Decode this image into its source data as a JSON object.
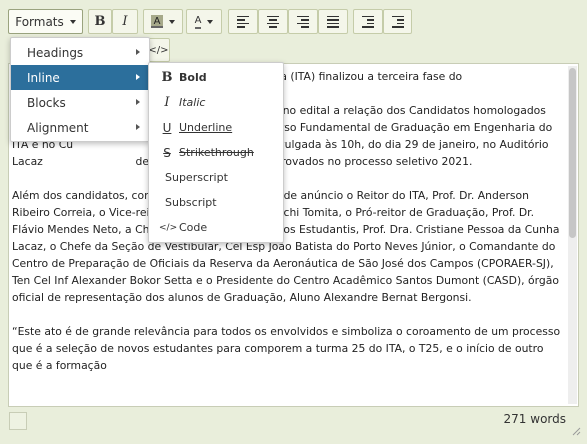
{
  "toolbar": {
    "formats_label": "Formats",
    "bold_glyph": "B",
    "italic_glyph": "I",
    "bgcolor_glyph": "A",
    "textcolor_glyph": "A",
    "code_glyph": "</>"
  },
  "menu": {
    "items": [
      {
        "label": "Headings"
      },
      {
        "label": "Inline"
      },
      {
        "label": "Blocks"
      },
      {
        "label": "Alignment"
      }
    ],
    "active_index": 1
  },
  "submenu": {
    "items": [
      {
        "label": "Bold",
        "icon": "B"
      },
      {
        "label": "Italic",
        "icon": "I"
      },
      {
        "label": "Underline",
        "icon": "U"
      },
      {
        "label": "Strikethrough",
        "icon": "S"
      },
      {
        "label": "Superscript",
        "icon": ""
      },
      {
        "label": "Subscript",
        "icon": ""
      },
      {
        "label": "Code",
        "icon": "</>"
      }
    ]
  },
  "editor": {
    "paragraphs": [
      "                                              lógico de Aeronáutica (ITA) finalizou a terceira fase do",
      "                                              cumentação exigida no edital a relação dos Candidatos homologados pela Junta Es                           matriculados no Curso Fundamental de Graduação em Engenharia do ITA e no Cu                           ais da Reserva, foi divulgada às 10h, do dia 29 de janeiro, no Auditório Lacaz                           definida a lista final dos aprovados no processo seletivo 2021.",
      "Além dos candidatos, compareceram à cerimônia de anúncio o Reitor do ITA, Prof. Dr. Anderson Ribeiro Correia, o Vice-reitor, Prof. Dr. Jesuíno Takachi Tomita, o Pró-reitor de Graduação, Prof. Dr. Flávio Mendes Neto, a Chefe da Divisão de Assuntos Estudantis, Prof. Dra. Cristiane Pessoa da Cunha Lacaz, o Chefe da Seção de Vestibular, Cel Esp João Batista do Porto Neves Júnior, o Comandante do Centro de Preparação de Oficiais da Reserva da Aeronáutica de São José dos Campos (CPORAER-SJ), Ten Cel Inf Alexander Bokor Setta e o Presidente do Centro Acadêmico Santos Dumont (CASD), órgão oficial de representação dos alunos de Graduação, Aluno Alexandre Bernat Bergonsi.",
      "“Este ato é de grande relevância para todos os envolvidos e simboliza o coroamento de um processo que é a seleção de novos estudantes para comporem a turma 25 do ITA, o T25, e o início de outro que é a formação"
    ]
  },
  "status": {
    "wordcount": "271 words"
  }
}
